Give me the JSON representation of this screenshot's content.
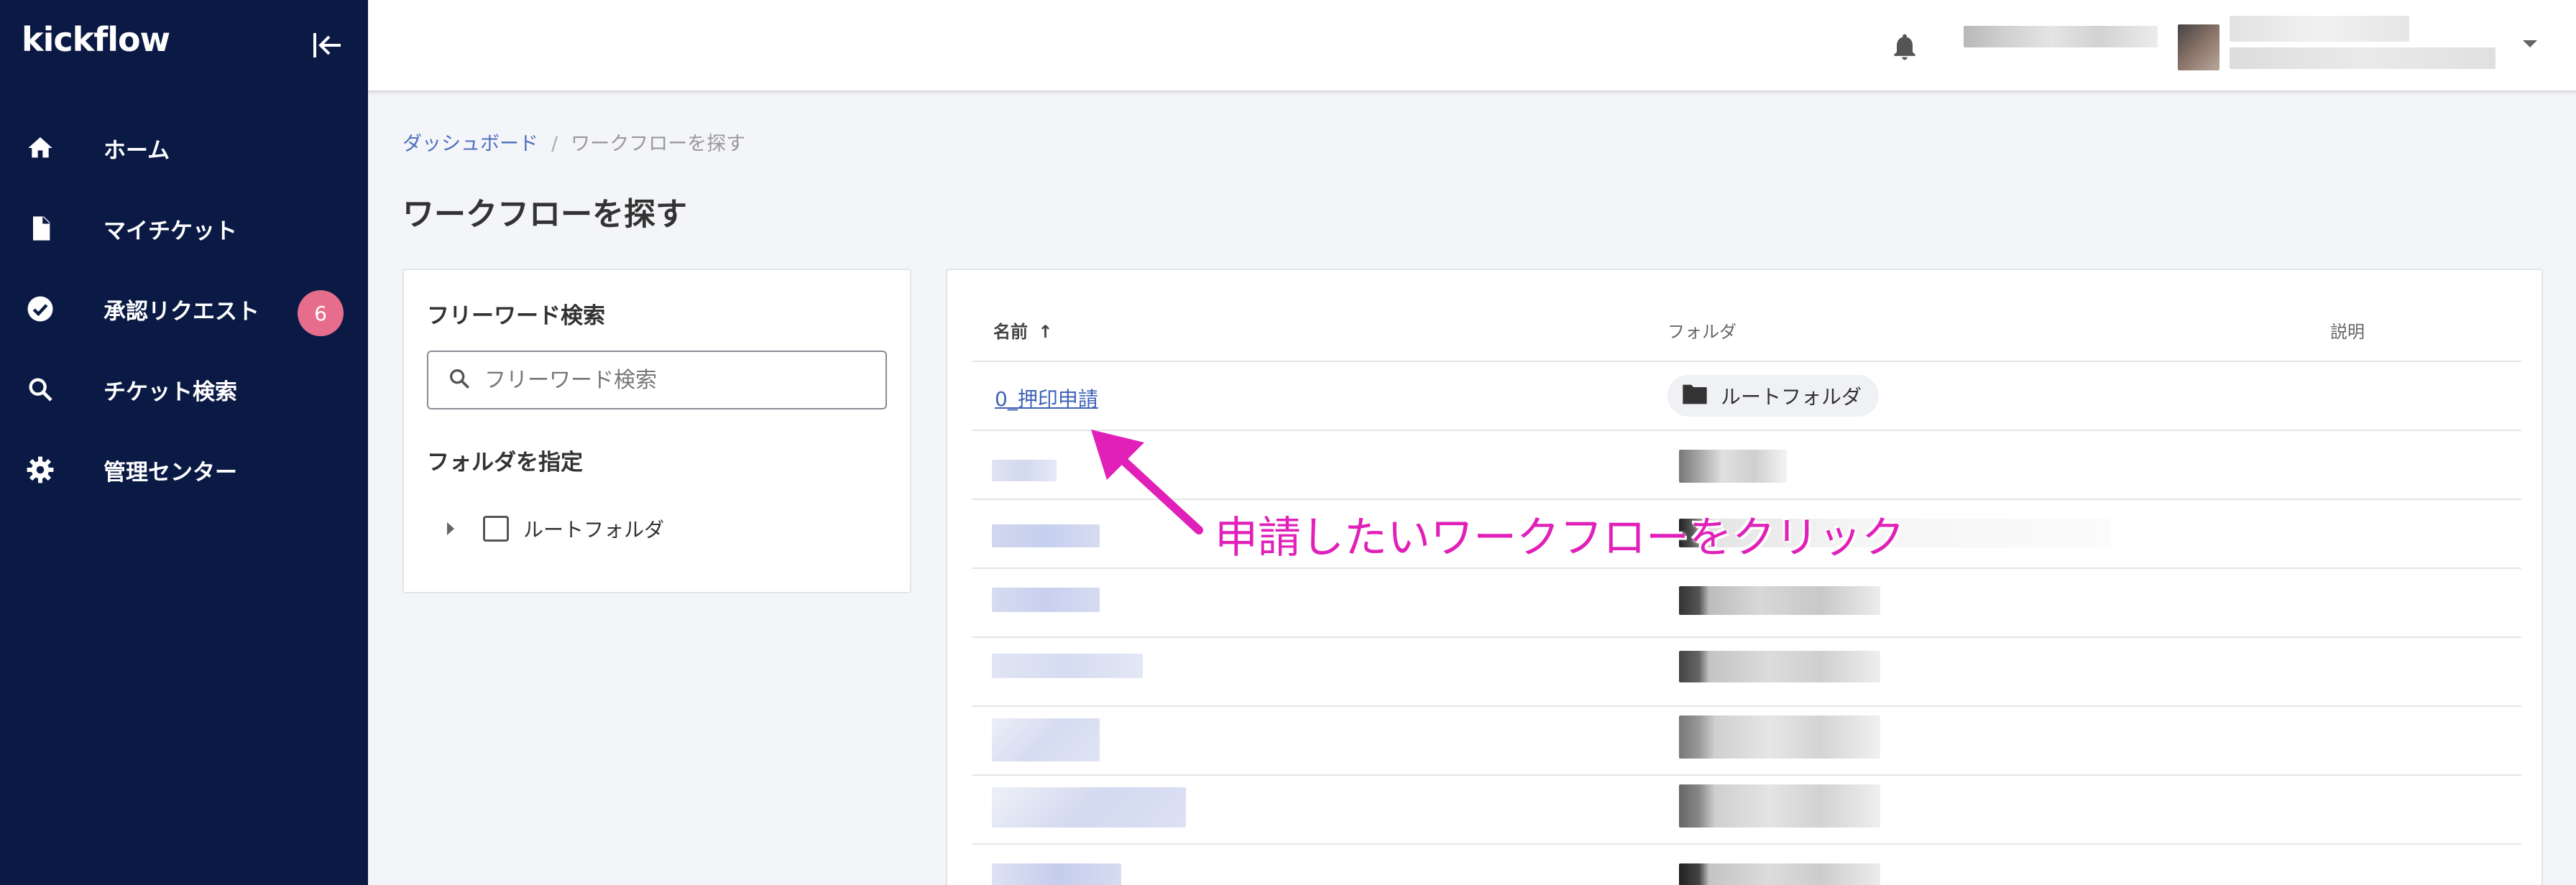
{
  "app": {
    "logo_text": "kickflow"
  },
  "sidebar": {
    "items": [
      {
        "label": "ホーム",
        "icon": "home-icon"
      },
      {
        "label": "マイチケット",
        "icon": "document-icon"
      },
      {
        "label": "承認リクエスト",
        "icon": "check-circle-icon",
        "badge": "6"
      },
      {
        "label": "チケット検索",
        "icon": "search-icon"
      },
      {
        "label": "管理センター",
        "icon": "gear-icon"
      }
    ]
  },
  "breadcrumb": {
    "parent": "ダッシュボード",
    "separator": "/",
    "current": "ワークフローを探す"
  },
  "page": {
    "title": "ワークフローを探す"
  },
  "filter": {
    "keyword_heading": "フリーワード検索",
    "search_placeholder": "フリーワード検索",
    "folder_heading": "フォルダを指定",
    "tree_root_label": "ルートフォルダ"
  },
  "table": {
    "columns": {
      "name": "名前",
      "folder": "フォルダ",
      "description": "説明"
    },
    "sort_indicator": "↑",
    "rows": [
      {
        "name": "0_押印申請",
        "folder": "ルートフォルダ"
      }
    ]
  },
  "annotation": {
    "text": "申請したいワークフローをクリック",
    "color": "#e020b8"
  },
  "colors": {
    "sidebar_bg": "#0b1a45",
    "badge": "#e66d8c",
    "link": "#3f63b8"
  }
}
